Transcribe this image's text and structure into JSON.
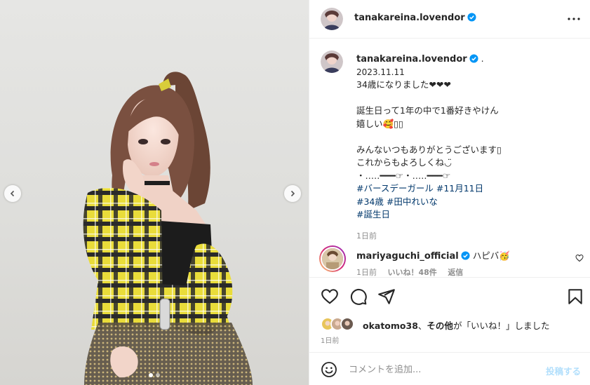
{
  "post": {
    "author": "tanakareina.lovendor",
    "author_suffix": ".",
    "more_icon": "more-horizontal-icon",
    "colors": {
      "link": "#00376b",
      "verified": "#0095f6",
      "muted": "#8e8e8e",
      "post_button": "#b2dffc"
    }
  },
  "media": {
    "slide_count": 2,
    "active_slide": 1,
    "prev_icon": "chevron-left-icon",
    "next_icon": "chevron-right-icon"
  },
  "caption": {
    "date": "2023.11.11",
    "line1": "34歳になりました❤︎❤︎❤︎",
    "line2": "誕生日って1年の中で1番好きやけん",
    "line3": "嬉しい🥰▯▯",
    "line4": "みんないつもありがとうございます▯",
    "line5": "これからもよろしくね◡̈",
    "line6": "・‥…━━━☞・‥…━━━☞",
    "tags_row1": [
      "#バースデーガール",
      "#11月11日"
    ],
    "tags_row2": [
      "#34歳",
      "#田中れいな"
    ],
    "tags_row3": [
      "#誕生日"
    ],
    "ago": "1日前"
  },
  "comment": {
    "user": "mariyaguchi_official",
    "text": "ハピバ🥳",
    "ago": "1日前",
    "likes": "いいね！48件",
    "reply": "返信"
  },
  "actions": {
    "like_icon": "heart-icon",
    "comment_icon": "comment-icon",
    "share_icon": "share-icon",
    "save_icon": "bookmark-icon"
  },
  "likes": {
    "user": "okatomo38",
    "sep": "、",
    "others": "その他",
    "suffix": "が「いいね！」しました",
    "ago": "1日前"
  },
  "add_comment": {
    "placeholder": "コメントを追加...",
    "post_label": "投稿する"
  }
}
